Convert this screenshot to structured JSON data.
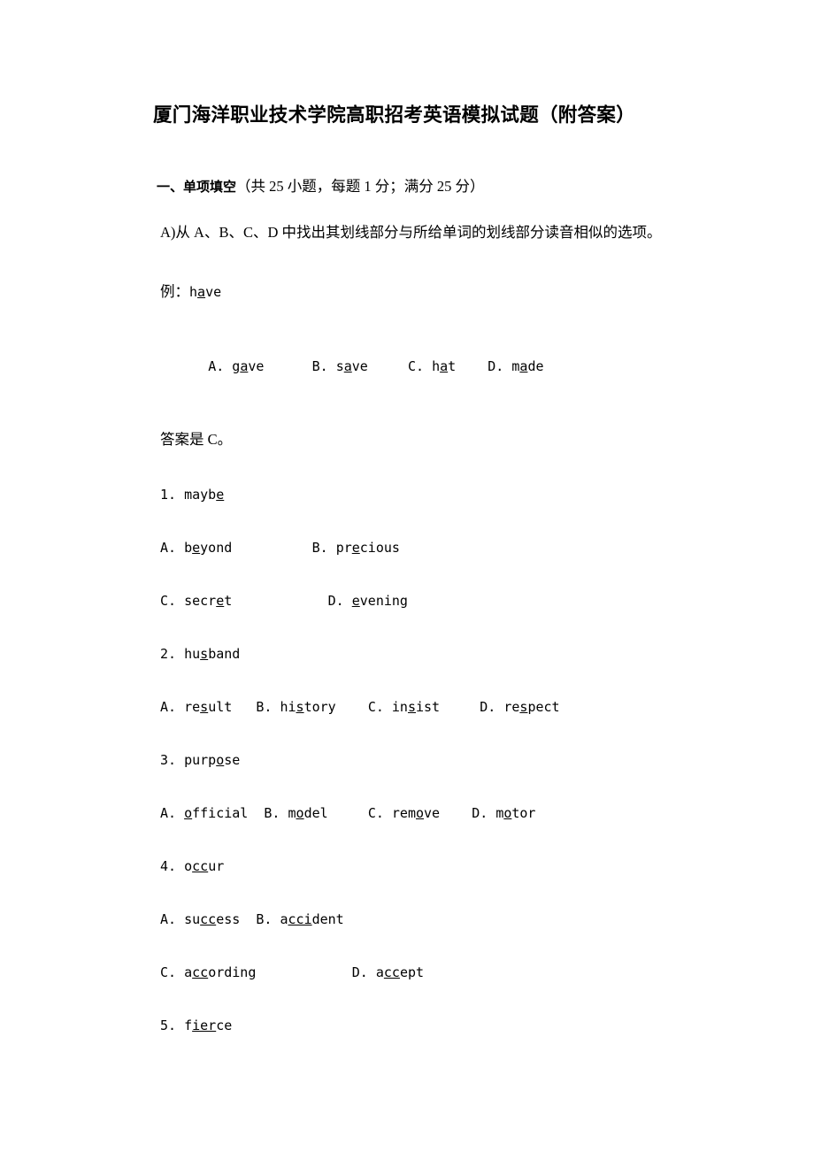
{
  "document": {
    "title": "厦门海洋职业技术学院高职招考英语模拟试题（附答案）",
    "section": {
      "number_label": "一、单项填空",
      "detail": "（共 25 小题，每题 1 分；满分 25 分）"
    },
    "instruction": {
      "line": "A)从 A、B、C、D 中找出其划线部分与所给单词的划线部分读音相似的选项。"
    },
    "example": {
      "prompt_label": "例：",
      "prompt_word_pre": "h",
      "prompt_word_underline": "a",
      "prompt_word_post": "ve",
      "options": [
        {
          "marker": "A.",
          "pre": "g",
          "ul": "a",
          "post": "ve"
        },
        {
          "marker": "B.",
          "pre": "s",
          "ul": "a",
          "post": "ve"
        },
        {
          "marker": "C.",
          "pre": "h",
          "ul": "a",
          "post": "t"
        },
        {
          "marker": "D.",
          "pre": "m",
          "ul": "a",
          "post": "de"
        }
      ],
      "answer": "答案是 C。"
    },
    "questions": [
      {
        "number": "1.",
        "stem_pre": "mayb",
        "stem_ul": "e",
        "stem_post": "",
        "layout": "two-by-two",
        "options": [
          {
            "marker": "A.",
            "pre": "b",
            "ul": "e",
            "post": "yond"
          },
          {
            "marker": "B.",
            "pre": "pr",
            "ul": "e",
            "post": "cious"
          },
          {
            "marker": "C.",
            "pre": "secr",
            "ul": "e",
            "post": "t"
          },
          {
            "marker": "D.",
            "pre": "",
            "ul": "e",
            "post": "vening"
          }
        ]
      },
      {
        "number": "2.",
        "stem_pre": "hu",
        "stem_ul": "s",
        "stem_post": "band",
        "layout": "single-row",
        "options": [
          {
            "marker": "A.",
            "pre": "re",
            "ul": "s",
            "post": "ult"
          },
          {
            "marker": "B.",
            "pre": "hi",
            "ul": "s",
            "post": "tory"
          },
          {
            "marker": "C.",
            "pre": "in",
            "ul": "s",
            "post": "ist"
          },
          {
            "marker": "D.",
            "pre": "re",
            "ul": "s",
            "post": "pect"
          }
        ]
      },
      {
        "number": "3.",
        "stem_pre": "purp",
        "stem_ul": "o",
        "stem_post": "se",
        "layout": "single-row",
        "options": [
          {
            "marker": "A.",
            "pre": "",
            "ul": "o",
            "post": "fficial"
          },
          {
            "marker": "B.",
            "pre": "m",
            "ul": "o",
            "post": "del"
          },
          {
            "marker": "C.",
            "pre": "rem",
            "ul": "o",
            "post": "ve"
          },
          {
            "marker": "D.",
            "pre": "m",
            "ul": "o",
            "post": "tor"
          }
        ]
      },
      {
        "number": "4.",
        "stem_pre": "o",
        "stem_ul": "cc",
        "stem_post": "ur",
        "layout": "two-by-two",
        "options": [
          {
            "marker": "A.",
            "pre": "su",
            "ul": "cc",
            "post": "ess"
          },
          {
            "marker": "B.",
            "pre": "a",
            "ul": "cci",
            "post": "dent"
          },
          {
            "marker": "C.",
            "pre": "a",
            "ul": "cc",
            "post": "ording"
          },
          {
            "marker": "D.",
            "pre": "a",
            "ul": "cc",
            "post": "ept"
          }
        ]
      },
      {
        "number": "5.",
        "stem_pre": "f",
        "stem_ul": "ier",
        "stem_post": "ce",
        "layout": "none",
        "options": []
      }
    ]
  }
}
